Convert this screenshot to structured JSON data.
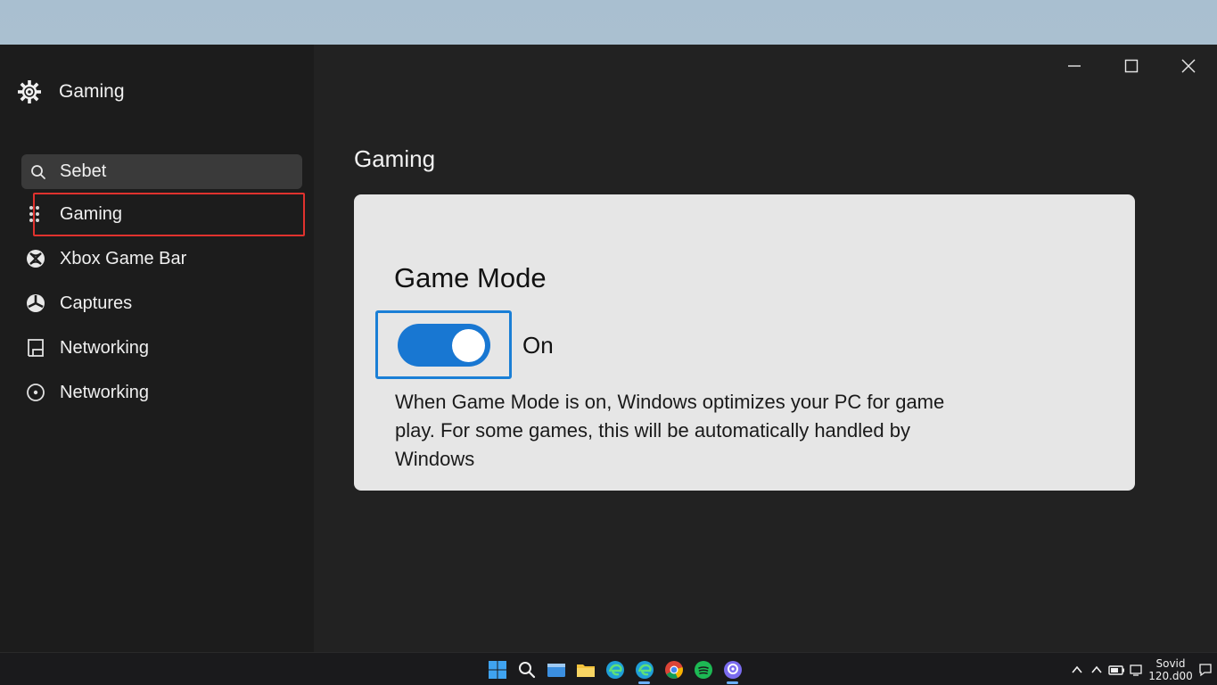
{
  "app": {
    "title": "Gaming"
  },
  "search": {
    "value": "Sebet",
    "placeholder": "Sebet"
  },
  "sidebar": {
    "items": [
      {
        "label": "Gaming",
        "icon": "game-dots-icon",
        "selected": true
      },
      {
        "label": "Xbox Game Bar",
        "icon": "xbox-icon",
        "selected": false
      },
      {
        "label": "Captures",
        "icon": "captures-icon",
        "selected": false
      },
      {
        "label": "Networking",
        "icon": "networking-icon",
        "selected": false
      },
      {
        "label": "Networking",
        "icon": "clock-circle-icon",
        "selected": false
      }
    ]
  },
  "main": {
    "page_title": "Gaming",
    "card": {
      "title": "Game Mode",
      "toggle_state": "On",
      "toggle_on": true,
      "description": "When Game Mode is on, Windows optimizes your PC for game play. For some games, this will be automatically handled by Windows"
    }
  },
  "taskbar": {
    "apps": [
      "windows-start-icon",
      "search-icon",
      "file-explorer-icon",
      "folder-icon",
      "edge-icon",
      "edge-icon",
      "chrome-icon",
      "spotify-icon",
      "app-icon"
    ],
    "clock_line1": "Sovid",
    "clock_line2": "120.d00"
  },
  "colors": {
    "accent": "#1877d2",
    "highlight_border": "#e0322e",
    "window_bg": "#222222",
    "sidebar_bg": "#1c1c1c",
    "card_bg": "#e6e6e6"
  }
}
